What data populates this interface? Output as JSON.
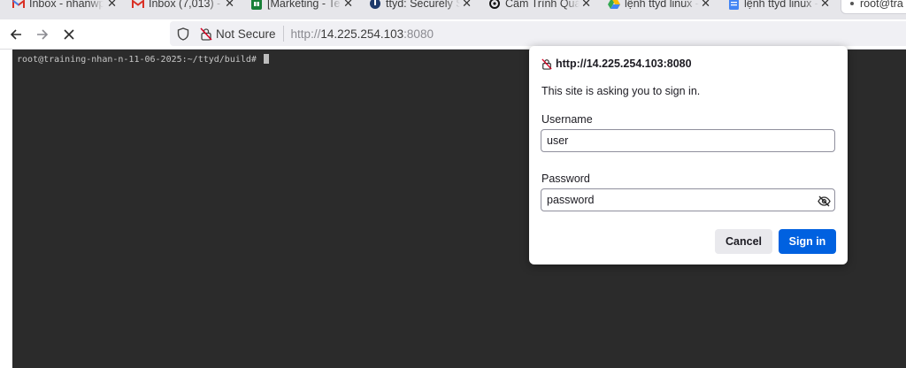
{
  "tabs": [
    {
      "title": "Inbox - nhanwp",
      "icon": "gmail-icon",
      "close": "✕"
    },
    {
      "title": "Inbox (7,013) - ",
      "icon": "gmail-icon",
      "close": "✕"
    },
    {
      "title": "[Marketing - Te",
      "icon": "sheets-icon",
      "close": "✕"
    },
    {
      "title": "ttyd: Securely S",
      "icon": "ttyd-icon",
      "close": "✕"
    },
    {
      "title": "Cấm Trình Quả",
      "icon": "threads-icon",
      "close": "✕"
    },
    {
      "title": "lệnh ttyd linux -",
      "icon": "drive-icon",
      "close": "✕"
    },
    {
      "title": "lệnh ttyd linux -",
      "icon": "docs-icon",
      "close": "✕"
    },
    {
      "title": "root@tra",
      "icon": "dot-icon",
      "close": ""
    }
  ],
  "navbar": {
    "back_icon": "back-arrow-icon",
    "forward_icon": "forward-arrow-icon",
    "stop_icon": "stop-icon",
    "not_secure_label": "Not Secure",
    "url_prefix": "http://",
    "url_host": "14.225.254.103",
    "url_port": ":8080"
  },
  "terminal": {
    "prompt": "root@training-nhan-n-11-06-2025:~/ttyd/build# "
  },
  "auth_dialog": {
    "origin": "http://14.225.254.103:8080",
    "message": "This site is asking you to sign in.",
    "username_label": "Username",
    "username_value": "user",
    "password_label": "Password",
    "password_value": "password",
    "cancel_label": "Cancel",
    "signin_label": "Sign in"
  },
  "colors": {
    "accent": "#0061e0",
    "terminal_bg": "#2b2b2b",
    "tabstrip_bg": "#e6e6ea"
  }
}
